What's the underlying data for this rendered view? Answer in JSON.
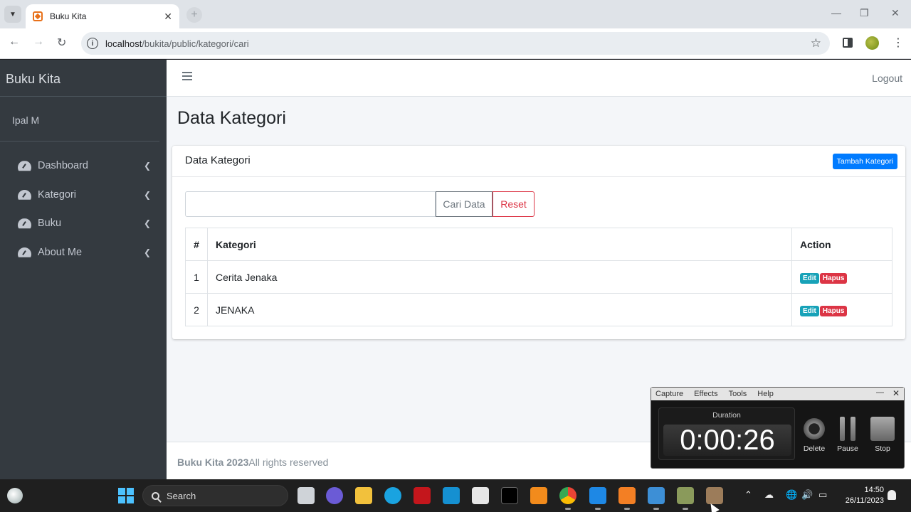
{
  "browser": {
    "tab_title": "Buku Kita",
    "url_host": "localhost",
    "url_path": "/bukita/public/kategori/cari"
  },
  "sidebar": {
    "brand": "Buku Kita",
    "user": "Ipal M",
    "items": [
      {
        "label": "Dashboard",
        "icon": "tachometer-icon"
      },
      {
        "label": "Kategori",
        "icon": "tachometer-icon"
      },
      {
        "label": "Buku",
        "icon": "tachometer-icon"
      },
      {
        "label": "About Me",
        "icon": "tachometer-icon"
      }
    ]
  },
  "topnav": {
    "logout_label": "Logout"
  },
  "main": {
    "page_title": "Data Kategori",
    "card_title": "Data Kategori",
    "add_button": "Tambah Kategori",
    "search": {
      "value": "",
      "placeholder": "",
      "search_button": "Cari Data",
      "reset_button": "Reset"
    },
    "table": {
      "headers": [
        "#",
        "Kategori",
        "Action"
      ],
      "rows": [
        {
          "no": "1",
          "kategori": "Cerita Jenaka",
          "edit": "Edit",
          "hapus": "Hapus"
        },
        {
          "no": "2",
          "kategori": "JENAKA",
          "edit": "Edit",
          "hapus": "Hapus"
        }
      ]
    }
  },
  "footer": {
    "brand_year": "Buku Kita 2023",
    "rights": "All rights reserved"
  },
  "recorder": {
    "menu": [
      "Capture",
      "Effects",
      "Tools",
      "Help"
    ],
    "duration_label": "Duration",
    "time": "0:00:26",
    "delete_label": "Delete",
    "pause_label": "Pause",
    "stop_label": "Stop"
  },
  "taskbar": {
    "search_label": "Search",
    "time": "14:50",
    "date": "26/11/2023"
  },
  "colors": {
    "sidebar_bg": "#343a40",
    "primary": "#007bff",
    "danger": "#dc3545",
    "info": "#17a2b8"
  }
}
